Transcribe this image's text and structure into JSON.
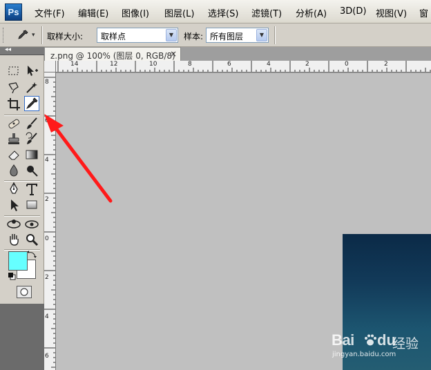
{
  "app": {
    "logo_text": "Ps"
  },
  "menu": {
    "items": [
      "文件(F)",
      "编辑(E)",
      "图像(I)",
      "图层(L)",
      "选择(S)",
      "滤镜(T)",
      "分析(A)",
      "3D(D)",
      "视图(V)",
      "窗"
    ]
  },
  "options": {
    "sample_size_label": "取样大小:",
    "sample_size_value": "取样点",
    "sample_label": "样本:",
    "sample_value": "所有图层"
  },
  "document": {
    "tab_title": "z.png @ 100% (图层 0, RGB/8)",
    "close_glyph": "×"
  },
  "rulers": {
    "horizontal": [
      "14",
      "12",
      "10",
      "8",
      "6",
      "4",
      "2",
      "0",
      "2"
    ],
    "vertical": [
      "8",
      "6",
      "4",
      "2",
      "0",
      "2",
      "4",
      "6"
    ]
  },
  "toolbox": {
    "collapse_glyph": "◂◂",
    "foreground_color": "#66ffff",
    "background_color": "#ffffff",
    "active_tool": "eyedropper-tool"
  },
  "annotation": {
    "arrow_color": "#ff1a1a"
  },
  "watermark": {
    "brand_a": "Bai",
    "brand_b": "du",
    "product": "经验",
    "url": "jingyan.baidu.com"
  }
}
